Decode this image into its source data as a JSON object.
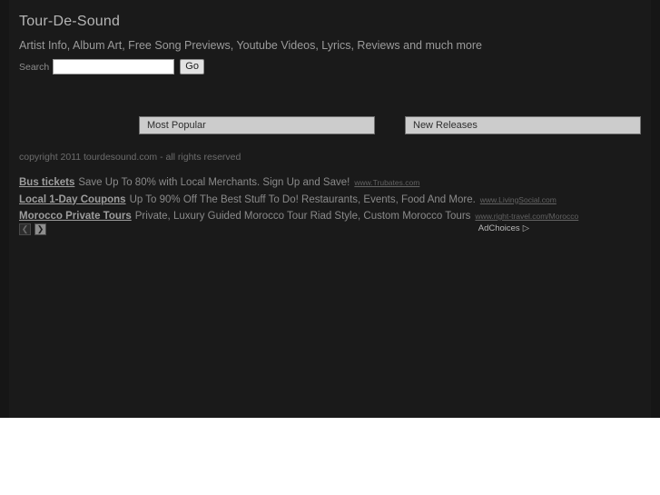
{
  "site": {
    "title": "Tour-De-Sound",
    "tagline": "Artist Info, Album Art, Free Song Previews, Youtube Videos, Lyrics, Reviews and much more",
    "copyright": "copyright 2011 tourdesound.com - all rights reserved",
    "background_color": "#1a1a1a",
    "text_color": "#9b9b9b"
  },
  "search": {
    "label": "Search",
    "value": "",
    "placeholder": "",
    "button_label": "Go"
  },
  "panels": [
    {
      "name": "most-popular",
      "title": "Most Popular"
    },
    {
      "name": "new-releases",
      "title": "New Releases"
    }
  ],
  "ads": {
    "items": [
      {
        "title": "Bus tickets",
        "description": "Save Up To 80% with Local Merchants. Sign Up and Save!",
        "url": "www.Trubates.com"
      },
      {
        "title": "Local 1-Day Coupons",
        "description": "Up To 90% Off The Best Stuff To Do! Restaurants, Events, Food And More.",
        "url": "www.LivingSocial.com"
      },
      {
        "title": "Morocco Private Tours",
        "description": "Private, Luxury Guided Morocco Tour Riad Style, Custom Morocco Tours",
        "url": "www.right-travel.com/Morocco"
      }
    ],
    "nav": {
      "prev_icon": "chevron-left",
      "prev_glyph": "❮",
      "next_icon": "chevron-right",
      "next_glyph": "❯"
    },
    "adchoices": {
      "label": "AdChoices",
      "icon": "adchoices-triangle",
      "glyph": "▷"
    }
  }
}
